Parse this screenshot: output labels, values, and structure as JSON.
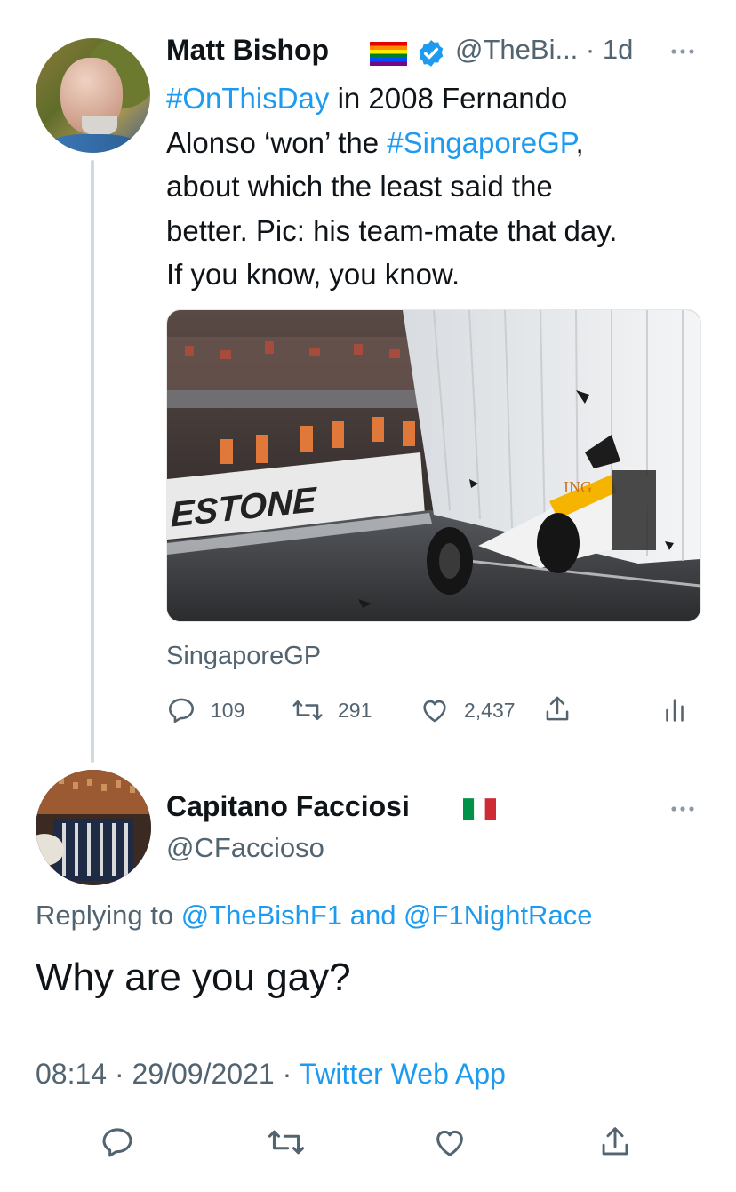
{
  "parent_tweet": {
    "author_name": "Matt Bishop",
    "handle_time": "@TheBi... · 1d",
    "text_lines": [
      [
        {
          "text": "#OnThisDay",
          "link": true
        },
        {
          "text": " in 2008 Fernando",
          "link": false
        }
      ],
      [
        {
          "text": "Alonso ‘won’ the ",
          "link": false
        },
        {
          "text": "#SingaporeGP",
          "link": true
        },
        {
          "text": ",",
          "link": false
        }
      ],
      [
        {
          "text": "about which the least said the",
          "link": false
        }
      ],
      [
        {
          "text": "better. Pic: his team-mate that day.",
          "link": false
        }
      ],
      [
        {
          "text": "If you know, you know.",
          "link": false
        }
      ]
    ],
    "media_banner_text": "ESTONE",
    "media_car_text": "ING",
    "card_label": "SingaporeGP",
    "replies": "109",
    "retweets": "291",
    "likes": "2,437"
  },
  "reply_tweet": {
    "author_name": "Capitano Facciosi",
    "handle": "@CFaccioso",
    "replying_prefix": "Replying to ",
    "replying_user1": "@TheBishF1",
    "replying_and": " and ",
    "replying_user2": "@F1NightRace",
    "text": "Why are you gay?",
    "time": "08:14",
    "separator1": " · ",
    "date": "29/09/2021",
    "separator2": " · ",
    "source": "Twitter Web App"
  },
  "colors": {
    "link": "#1d9bf0",
    "secondary_text": "#536471",
    "primary_text": "#0f1419",
    "thread_line": "#cfd9de"
  },
  "icons": [
    "rainbow-flag-icon",
    "verified-badge-icon",
    "more-icon",
    "reply-icon",
    "retweet-icon",
    "like-icon",
    "share-icon",
    "analytics-icon",
    "italy-flag-icon"
  ]
}
